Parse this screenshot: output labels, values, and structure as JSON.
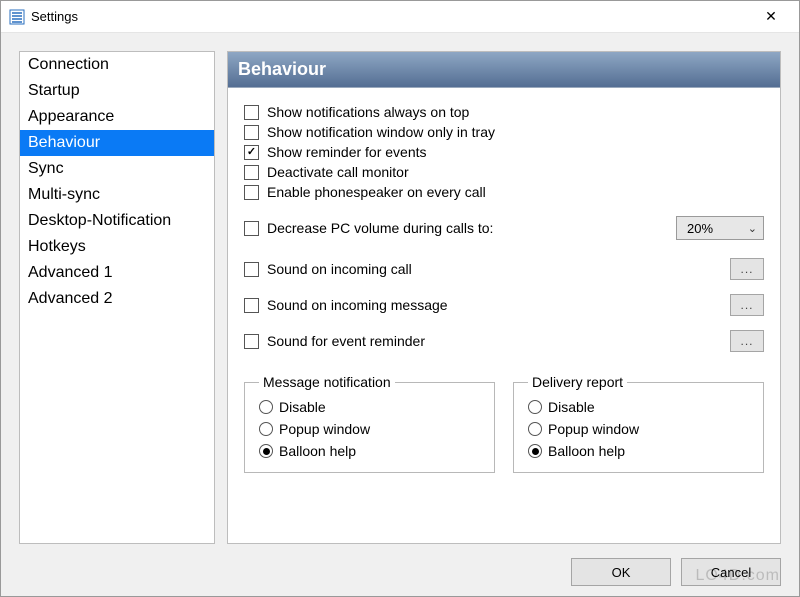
{
  "window": {
    "title": "Settings",
    "close_glyph": "✕"
  },
  "sidebar": {
    "items": [
      {
        "label": "Connection",
        "selected": false
      },
      {
        "label": "Startup",
        "selected": false
      },
      {
        "label": "Appearance",
        "selected": false
      },
      {
        "label": "Behaviour",
        "selected": true
      },
      {
        "label": "Sync",
        "selected": false
      },
      {
        "label": "Multi-sync",
        "selected": false
      },
      {
        "label": "Desktop-Notification",
        "selected": false
      },
      {
        "label": "Hotkeys",
        "selected": false
      },
      {
        "label": "Advanced 1",
        "selected": false
      },
      {
        "label": "Advanced 2",
        "selected": false
      }
    ]
  },
  "panel": {
    "title": "Behaviour",
    "checks": [
      {
        "label": "Show notifications always on top",
        "checked": false
      },
      {
        "label": "Show notification window only in tray",
        "checked": false
      },
      {
        "label": "Show reminder for events",
        "checked": true
      },
      {
        "label": "Deactivate call monitor",
        "checked": false
      },
      {
        "label": "Enable phonespeaker on every call",
        "checked": false
      }
    ],
    "volume": {
      "label": "Decrease PC volume during calls to:",
      "checked": false,
      "value": "20%"
    },
    "sounds": [
      {
        "label": "Sound on incoming call",
        "checked": false,
        "browse": "..."
      },
      {
        "label": "Sound on incoming message",
        "checked": false,
        "browse": "..."
      },
      {
        "label": "Sound for event reminder",
        "checked": false,
        "browse": "..."
      }
    ],
    "groups": [
      {
        "legend": "Message notification",
        "options": [
          {
            "label": "Disable",
            "checked": false
          },
          {
            "label": "Popup window",
            "checked": false
          },
          {
            "label": "Balloon help",
            "checked": true
          }
        ]
      },
      {
        "legend": "Delivery report",
        "options": [
          {
            "label": "Disable",
            "checked": false
          },
          {
            "label": "Popup window",
            "checked": false
          },
          {
            "label": "Balloon help",
            "checked": true
          }
        ]
      }
    ]
  },
  "buttons": {
    "ok": "OK",
    "cancel": "Cancel"
  },
  "watermark": "LO4D.com"
}
